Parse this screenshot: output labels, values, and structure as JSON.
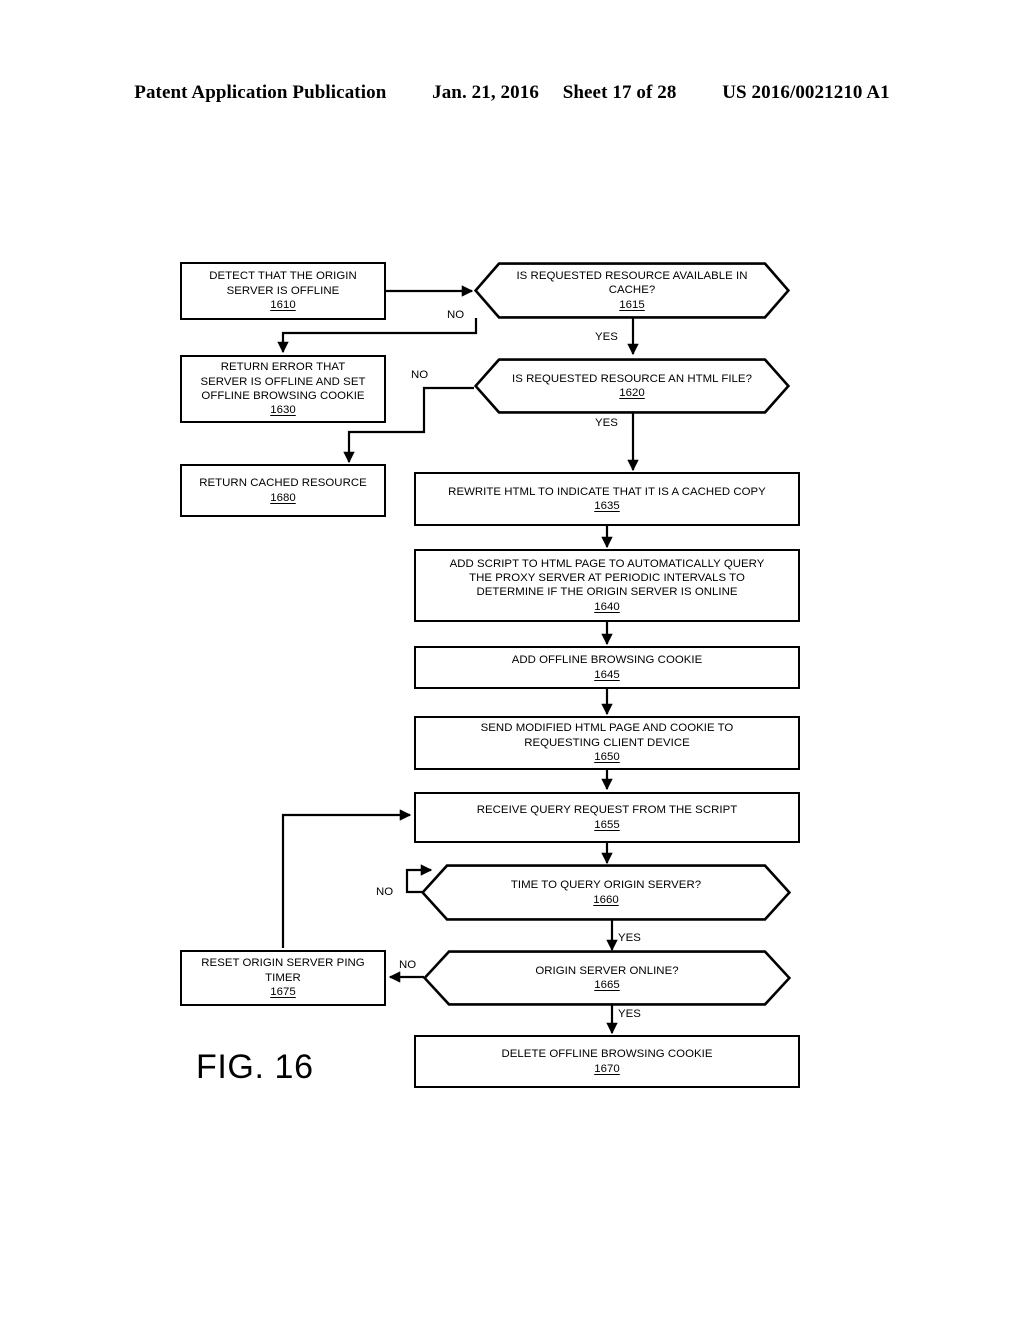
{
  "header": {
    "publication": "Patent Application Publication",
    "date": "Jan. 21, 2016",
    "sheet": "Sheet 17 of 28",
    "patent_number": "US 2016/0021210 A1"
  },
  "figure": {
    "caption": "FIG. 16",
    "nodes": [
      {
        "id": "1610",
        "shape": "process",
        "text": "DETECT THAT THE ORIGIN\nSERVER IS OFFLINE",
        "ref": "1610"
      },
      {
        "id": "1615",
        "shape": "decision",
        "text": "IS REQUESTED RESOURCE AVAILABLE IN\nCACHE?",
        "ref": "1615"
      },
      {
        "id": "1630",
        "shape": "process",
        "text": "RETURN ERROR THAT\nSERVER IS OFFLINE AND SET\nOFFLINE BROWSING COOKIE",
        "ref": "1630"
      },
      {
        "id": "1620",
        "shape": "decision",
        "text": "IS REQUESTED RESOURCE AN HTML FILE?",
        "ref": "1620"
      },
      {
        "id": "1680",
        "shape": "process",
        "text": "RETURN CACHED RESOURCE",
        "ref": "1680"
      },
      {
        "id": "1635",
        "shape": "process",
        "text": "REWRITE HTML TO INDICATE THAT IT IS A CACHED COPY",
        "ref": "1635"
      },
      {
        "id": "1640",
        "shape": "process",
        "text": "ADD SCRIPT TO HTML PAGE TO AUTOMATICALLY QUERY\nTHE PROXY SERVER AT PERIODIC INTERVALS TO\nDETERMINE IF THE ORIGIN  SERVER IS ONLINE",
        "ref": "1640"
      },
      {
        "id": "1645",
        "shape": "process",
        "text": "ADD OFFLINE BROWSING COOKIE",
        "ref": "1645"
      },
      {
        "id": "1650",
        "shape": "process",
        "text": "SEND MODIFIED HTML PAGE AND COOKIE TO\nREQUESTING CLIENT DEVICE",
        "ref": "1650"
      },
      {
        "id": "1655",
        "shape": "process",
        "text": "RECEIVE QUERY REQUEST FROM THE SCRIPT",
        "ref": "1655"
      },
      {
        "id": "1660",
        "shape": "decision",
        "text": "TIME TO QUERY ORIGIN  SERVER?",
        "ref": "1660"
      },
      {
        "id": "1675",
        "shape": "process",
        "text": "RESET ORIGIN  SERVER PING\nTIMER",
        "ref": "1675"
      },
      {
        "id": "1665",
        "shape": "decision",
        "text": "ORIGIN  SERVER ONLINE?",
        "ref": "1665"
      },
      {
        "id": "1670",
        "shape": "process",
        "text": "DELETE OFFLINE BROWSING COOKIE",
        "ref": "1670"
      }
    ],
    "edge_labels": [
      {
        "id": "no-1615",
        "text": "NO"
      },
      {
        "id": "yes-1615",
        "text": "YES"
      },
      {
        "id": "no-1620",
        "text": "NO"
      },
      {
        "id": "yes-1620",
        "text": "YES"
      },
      {
        "id": "no-1660",
        "text": "NO"
      },
      {
        "id": "yes-1660",
        "text": "YES"
      },
      {
        "id": "no-1665",
        "text": "NO"
      },
      {
        "id": "yes-1665",
        "text": "YES"
      }
    ]
  }
}
